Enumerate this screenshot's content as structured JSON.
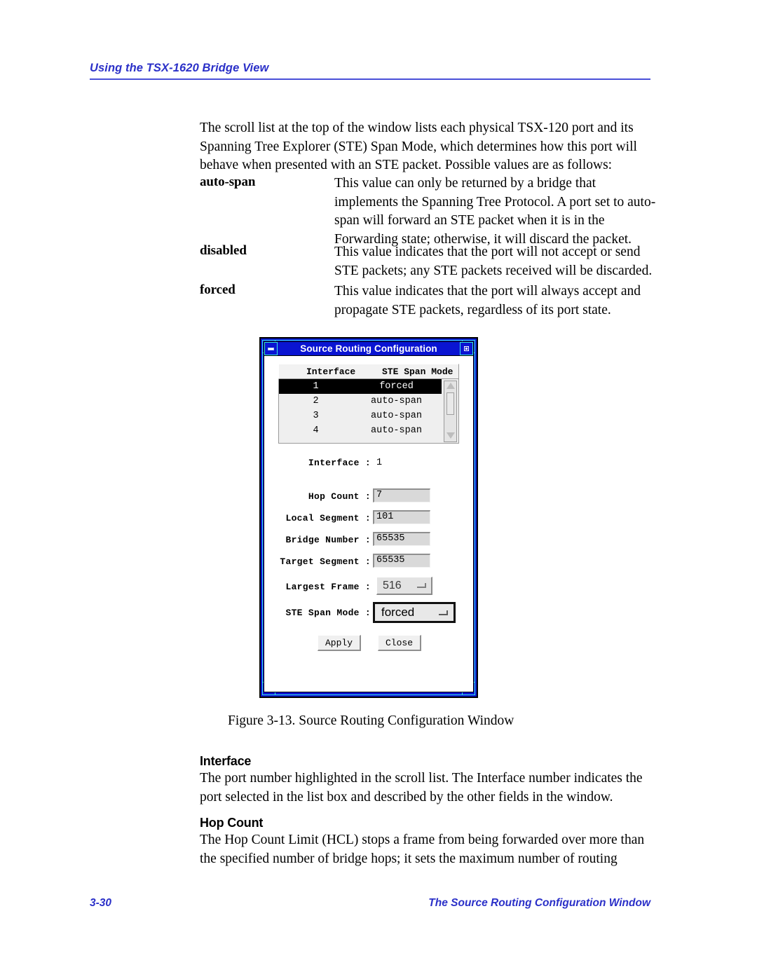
{
  "header": {
    "title": "Using the TSX-1620 Bridge View"
  },
  "intro": {
    "paragraph": "The scroll list at the top of the window lists each physical TSX-120 port and its Spanning Tree Explorer (STE) Span Mode, which determines how this port will behave when presented with an STE packet. Possible values are as follows:"
  },
  "definitions": [
    {
      "term": "auto-span",
      "description": "This value can only be returned by a bridge that implements the Spanning Tree Protocol. A port set to auto-span will forward an STE packet when it is in the Forwarding state; otherwise, it will discard the packet."
    },
    {
      "term": "disabled",
      "description": "This value indicates that the port will not accept or send STE packets; any STE packets received will be discarded."
    },
    {
      "term": "forced",
      "description": "This value indicates that the port will always accept and propagate STE packets, regardless of its port state."
    }
  ],
  "figure": {
    "caption": "Figure 3-13.  Source Routing Configuration Window",
    "dialog": {
      "title": "Source Routing Configuration",
      "minimize_icon": "minimize-icon",
      "maximize_icon": "maximize-icon",
      "list": {
        "columns": [
          "Interface",
          "STE Span Mode"
        ],
        "rows": [
          {
            "interface": "1",
            "mode": "forced",
            "selected": true
          },
          {
            "interface": "2",
            "mode": "auto-span",
            "selected": false
          },
          {
            "interface": "3",
            "mode": "auto-span",
            "selected": false
          },
          {
            "interface": "4",
            "mode": "auto-span",
            "selected": false
          }
        ],
        "scrollbar": {
          "up_icon": "scroll-up-arrow-icon",
          "down_icon": "scroll-down-arrow-icon"
        }
      },
      "fields": {
        "interface_label": "Interface :",
        "interface_value": "1",
        "hop_count_label": "Hop Count :",
        "hop_count_value": "7",
        "local_segment_label": "Local Segment :",
        "local_segment_value": "101",
        "bridge_number_label": "Bridge Number :",
        "bridge_number_value": "65535",
        "target_segment_label": "Target Segment :",
        "target_segment_value": "65535",
        "largest_frame_label": "Largest Frame :",
        "largest_frame_value": "516",
        "ste_span_mode_label": "STE Span Mode :",
        "ste_span_mode_value": "forced"
      },
      "buttons": {
        "apply": "Apply",
        "close": "Close"
      }
    }
  },
  "sections": [
    {
      "heading": "Interface",
      "body": "The port number highlighted in the scroll list. The Interface number indicates the port selected in the list box and described by the other fields in the window."
    },
    {
      "heading": "Hop Count",
      "body": "The Hop Count Limit (HCL) stops a frame from being forwarded over more than the specified number of bridge hops; it sets the maximum number of routing"
    }
  ],
  "footer": {
    "page_number": "3-30",
    "section_title": "The Source Routing Configuration Window"
  },
  "colors": {
    "accent_blue": "#2b30c8",
    "titlebar_blue": "#0a14d2",
    "frame_cyan": "#37e3e3"
  }
}
